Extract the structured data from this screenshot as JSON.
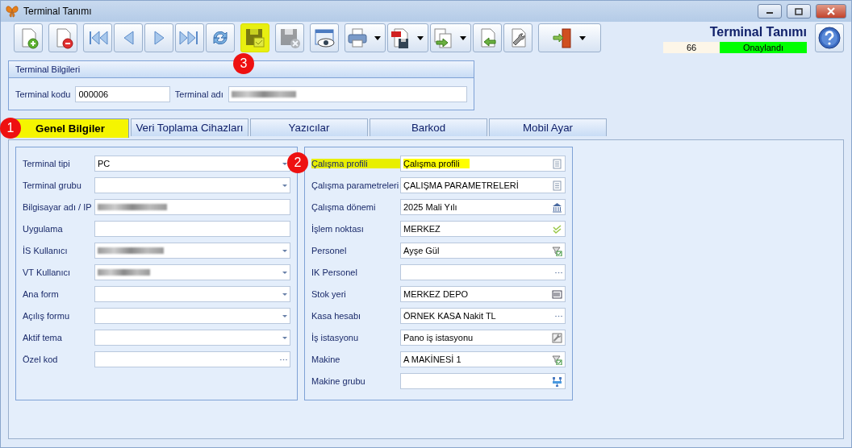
{
  "window": {
    "title": "Terminal Tanımı"
  },
  "toolbar": [
    {
      "dropdown": false,
      "highlighted": false,
      "disabled": false
    },
    {
      "dropdown": false,
      "highlighted": false,
      "disabled": false
    },
    {
      "dropdown": false,
      "highlighted": false,
      "disabled": false
    },
    {
      "dropdown": false,
      "highlighted": false,
      "disabled": false
    },
    {
      "dropdown": false,
      "highlighted": false,
      "disabled": false
    },
    {
      "dropdown": false,
      "highlighted": false,
      "disabled": false
    },
    {
      "dropdown": false,
      "highlighted": false,
      "disabled": false
    },
    {
      "dropdown": false,
      "highlighted": true,
      "disabled": false,
      "badge": "3"
    },
    {
      "dropdown": false,
      "highlighted": false,
      "disabled": true
    },
    {
      "dropdown": false,
      "highlighted": false,
      "disabled": false
    },
    {
      "dropdown": true,
      "highlighted": false,
      "disabled": false
    },
    {
      "dropdown": true,
      "highlighted": false,
      "disabled": false
    },
    {
      "dropdown": true,
      "highlighted": false,
      "disabled": false
    },
    {
      "dropdown": false,
      "highlighted": false,
      "disabled": false
    },
    {
      "dropdown": false,
      "highlighted": false,
      "disabled": false
    },
    {
      "dropdown": true,
      "highlighted": false,
      "disabled": false
    }
  ],
  "header": {
    "title": "Terminal Tanımı",
    "record_number": "66",
    "status": "Onaylandı"
  },
  "terminal_info": {
    "title": "Terminal Bilgileri",
    "fields": [
      {
        "label": "Terminal kodu",
        "value": "000006",
        "redacted": false
      },
      {
        "label": "Terminal adı",
        "redacted": true
      }
    ]
  },
  "tabs": [
    {
      "label": "Genel Bilgiler",
      "selected": true,
      "highlighted": true,
      "badge": "1"
    },
    {
      "label": "Veri Toplama Cihazları",
      "selected": false,
      "highlighted": false
    },
    {
      "label": "Yazıcılar",
      "selected": false,
      "highlighted": false
    },
    {
      "label": "Barkod",
      "selected": false,
      "highlighted": false
    },
    {
      "label": "Mobil Ayar",
      "selected": false,
      "highlighted": false
    }
  ],
  "general_fields": [
    {
      "label": "Terminal tipi",
      "value": "PC",
      "kind": "combo",
      "redacted": false
    },
    {
      "label": "Terminal grubu",
      "kind": "combo",
      "redacted": false
    },
    {
      "label": "Bilgisayar adı / IP",
      "kind": "text",
      "redacted": true
    },
    {
      "label": "Uygulama",
      "kind": "text",
      "redacted": false
    },
    {
      "label": "İS Kullanıcı",
      "kind": "combo",
      "redacted": true
    },
    {
      "label": "VT Kullanıcı",
      "kind": "combo",
      "redacted": true
    },
    {
      "label": "Ana form",
      "kind": "combo",
      "redacted": false
    },
    {
      "label": "Açılış formu",
      "kind": "combo",
      "redacted": false
    },
    {
      "label": "Aktif tema",
      "kind": "combo",
      "redacted": false
    },
    {
      "label": "Özel kod",
      "kind": "ellipsis",
      "redacted": false
    }
  ],
  "work_fields": [
    {
      "label": "Çalışma profili",
      "value": "Çalışma profili",
      "kind": "list",
      "highlighted": true,
      "badge": "2"
    },
    {
      "label": "Çalışma parametreleri",
      "value": "ÇALIŞMA PARAMETRELERİ",
      "kind": "list",
      "highlighted": false
    },
    {
      "label": "Çalışma dönemi",
      "value": "2025 Mali Yılı",
      "kind": "bank",
      "highlighted": false
    },
    {
      "label": "İşlem noktası",
      "value": "MERKEZ",
      "kind": "check",
      "highlighted": false
    },
    {
      "label": "Personel",
      "value": "Ayşe Gül",
      "kind": "filter",
      "highlighted": false
    },
    {
      "label": "IK Personel",
      "kind": "ellipsis",
      "highlighted": false
    },
    {
      "label": "Stok yeri",
      "value": "MERKEZ DEPO",
      "kind": "barcode",
      "highlighted": false
    },
    {
      "label": "Kasa hesabı",
      "value": "ÖRNEK KASA Nakit TL",
      "kind": "ellipsis",
      "highlighted": false
    },
    {
      "label": "İş istasyonu",
      "value": "Pano iş istasyonu",
      "kind": "wrench",
      "highlighted": false
    },
    {
      "label": "Makine",
      "value": "A MAKİNESİ 1",
      "kind": "filter",
      "highlighted": false
    },
    {
      "label": "Makine grubu",
      "kind": "network",
      "highlighted": false
    }
  ]
}
